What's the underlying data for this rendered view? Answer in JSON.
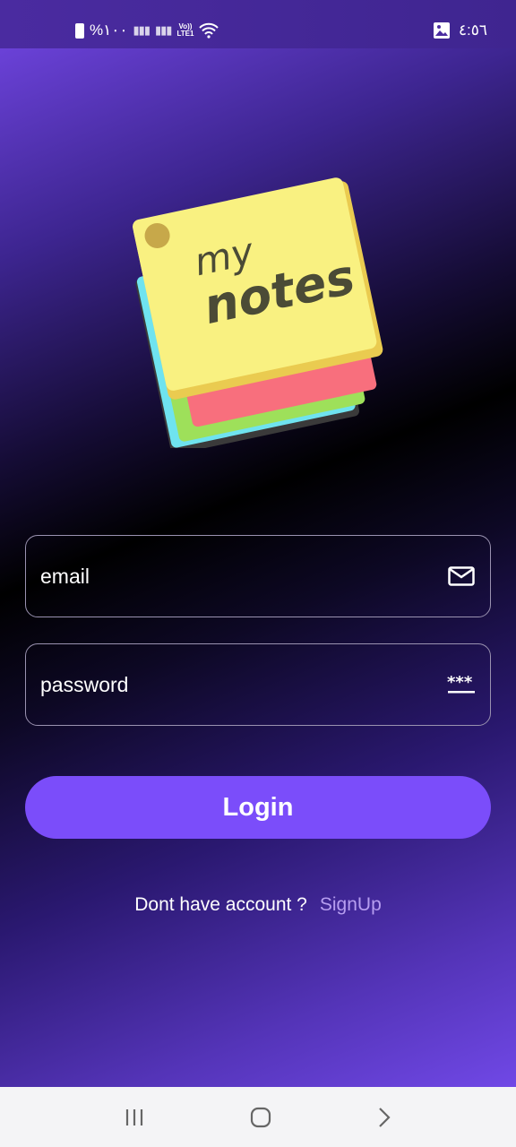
{
  "status_bar": {
    "battery": "%١٠٠",
    "network": "LTE1",
    "volte": "Vo))",
    "time": "٤:٥٦"
  },
  "logo": {
    "text_line1": "my",
    "text_line2": "notes"
  },
  "form": {
    "email_placeholder": "email",
    "password_placeholder": "password",
    "login_label": "Login"
  },
  "footer": {
    "prompt": "Dont have account ?",
    "signup_label": "SignUp"
  },
  "colors": {
    "accent": "#7b4dfa",
    "link": "#b79ef0"
  }
}
